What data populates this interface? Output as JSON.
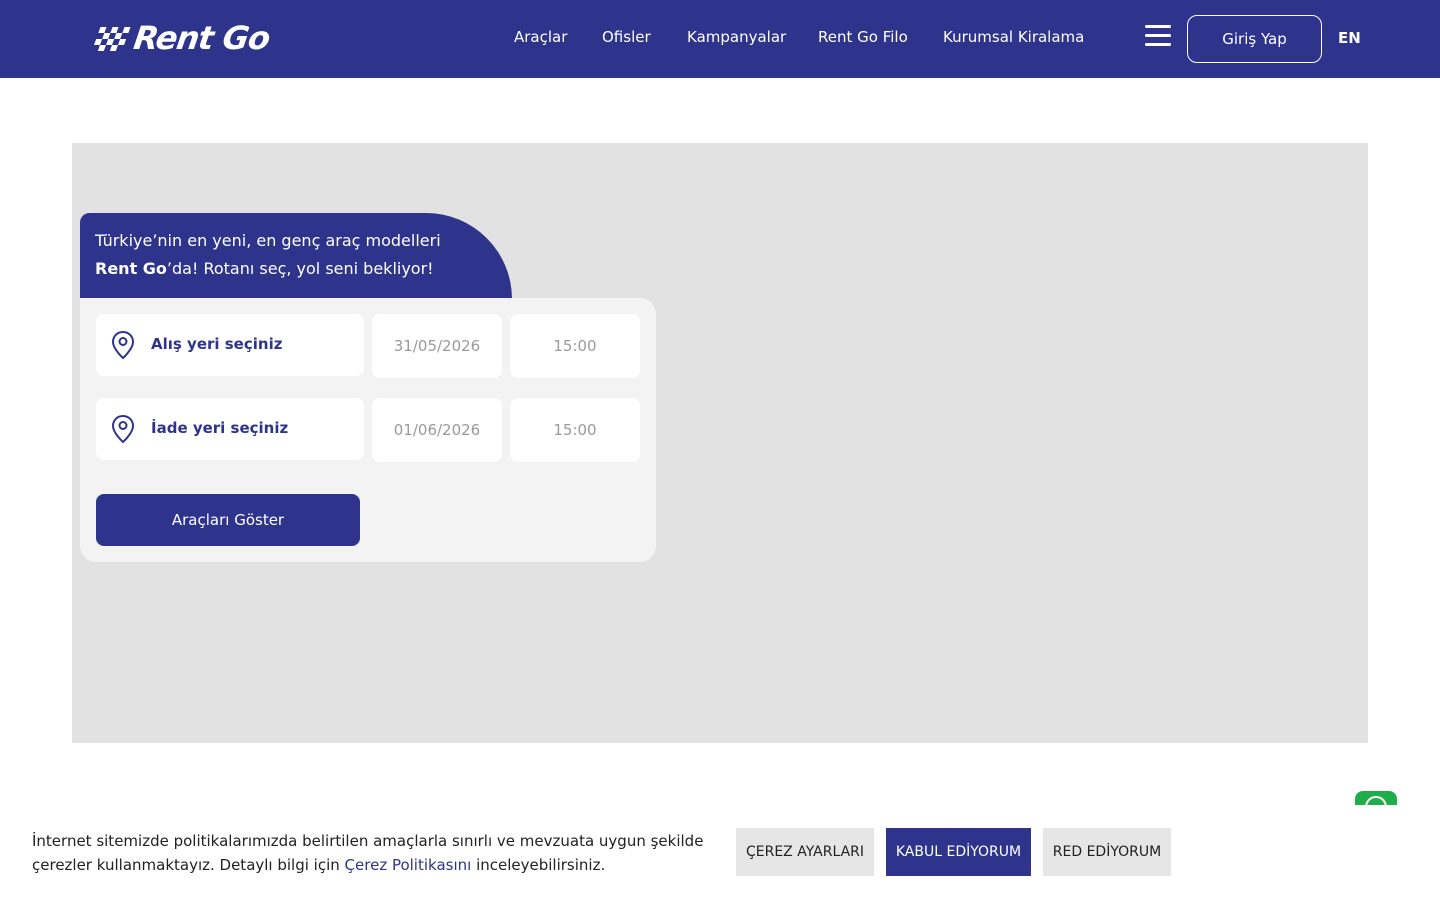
{
  "header": {
    "logo_text": "Rent Go",
    "nav": [
      {
        "label": "Araçlar"
      },
      {
        "label": "Ofisler"
      },
      {
        "label": "Kampanyalar"
      },
      {
        "label": "Rent Go Filo"
      },
      {
        "label": "Kurumsal Kiralama"
      }
    ],
    "menu_icon": "hamburger-menu-icon",
    "login_label": "Giriş Yap",
    "language_label": "EN"
  },
  "hero": {
    "tagline_line1": "Türkiye’nin en yeni, en genç araç modelleri",
    "tagline_brand": "Rent Go",
    "tagline_line2_rest": "’da! Rotanı seç, yol seni bekliyor!",
    "pickup": {
      "location_placeholder": "Alış yeri seçiniz",
      "date": "31/05/2026",
      "time": "15:00"
    },
    "return": {
      "location_placeholder": "İade yeri seçiniz",
      "date": "01/06/2026",
      "time": "15:00"
    },
    "submit_label": "Araçları Göster"
  },
  "cookie": {
    "text_part1": "İnternet sitemizde politikalarımızda belirtilen amaçlarla sınırlı ve mevzuata uygun şekilde çerezler kullanmaktayız. Detaylı bilgi için ",
    "link_label": "Çerez Politikasını",
    "text_part2": " inceleyebilirsiniz.",
    "settings_label": "ÇEREZ AYARLARI",
    "accept_label": "KABUL EDİYORUM",
    "reject_label": "RED EDİYORUM"
  },
  "colors": {
    "brand": "#2e348c",
    "hero_bg": "#e2e2e2",
    "card_bg": "#f3f3f3",
    "whatsapp": "#1ead4a"
  }
}
